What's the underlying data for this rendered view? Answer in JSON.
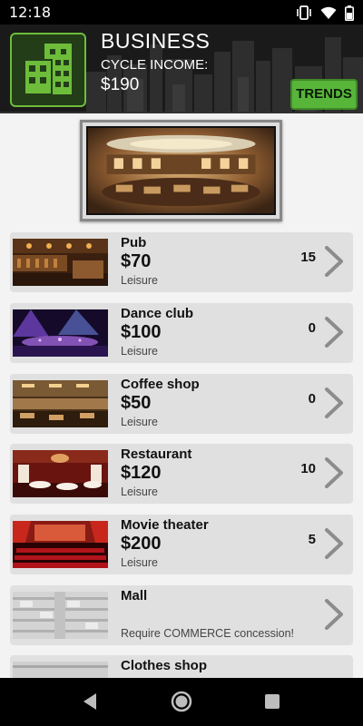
{
  "status_bar": {
    "time": "12:18"
  },
  "header": {
    "title": "BUSINESS",
    "subtitle": "CYCLE INCOME:",
    "income": "$190",
    "trends_label": "TRENDS"
  },
  "colors": {
    "accent_green": "#57b53a",
    "row_bg": "#e0e0e0",
    "page_bg": "#f3f3f3"
  },
  "businesses": [
    {
      "name": "Pub",
      "price": "$70",
      "category": "Leisure",
      "count": "15"
    },
    {
      "name": "Dance club",
      "price": "$100",
      "category": "Leisure",
      "count": "0"
    },
    {
      "name": "Coffee shop",
      "price": "$50",
      "category": "Leisure",
      "count": "0"
    },
    {
      "name": "Restaurant",
      "price": "$120",
      "category": "Leisure",
      "count": "10"
    },
    {
      "name": "Movie theater",
      "price": "$200",
      "category": "Leisure",
      "count": "5"
    },
    {
      "name": "Mall",
      "price": "",
      "category": "Require COMMERCE concession!",
      "count": ""
    },
    {
      "name": "Clothes shop",
      "price": "",
      "category": "",
      "count": ""
    }
  ],
  "icons": {
    "logo": "office-building-icon",
    "chevron": "chevron-right-icon"
  }
}
